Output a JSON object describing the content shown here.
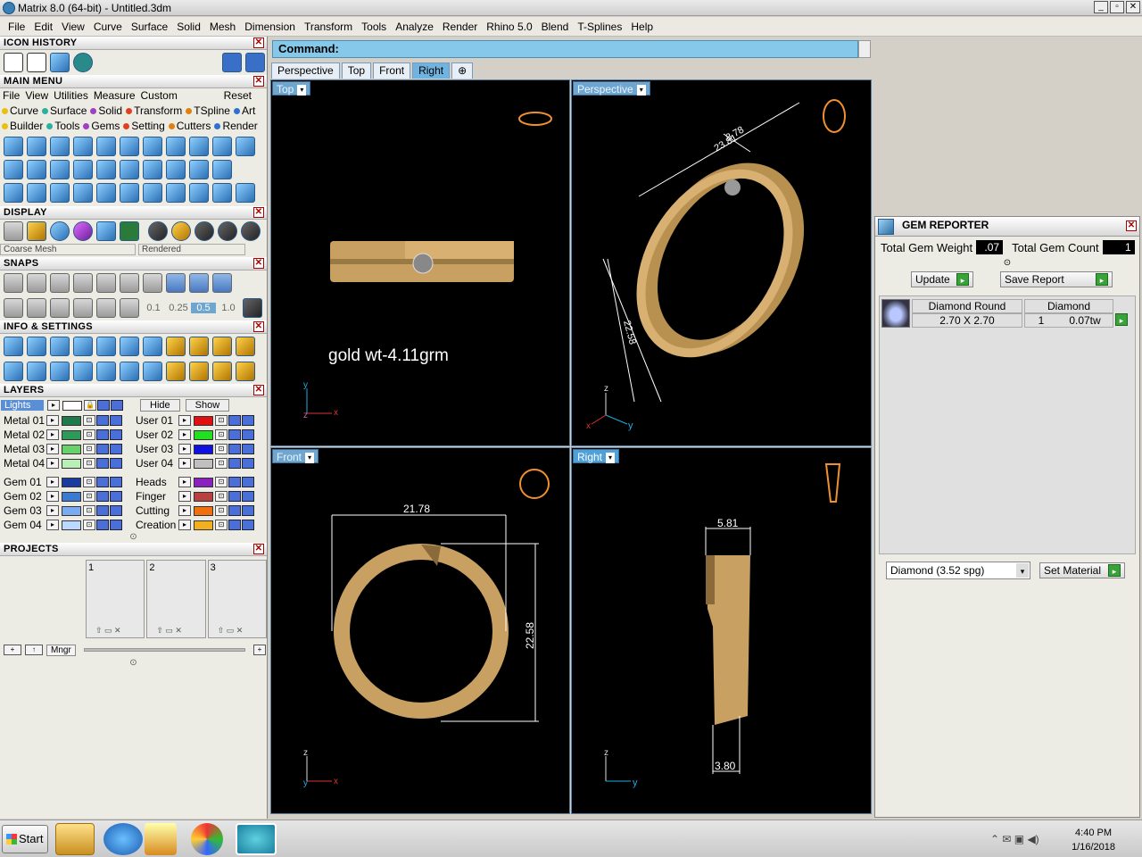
{
  "window": {
    "title": "Matrix 8.0 (64-bit) - Untitled.3dm"
  },
  "menubar": [
    "File",
    "Edit",
    "View",
    "Curve",
    "Surface",
    "Solid",
    "Mesh",
    "Dimension",
    "Transform",
    "Tools",
    "Analyze",
    "Render",
    "Rhino 5.0",
    "Blend",
    "T-Splines",
    "Help"
  ],
  "panels": {
    "icon_history": "ICON HISTORY",
    "main_menu": "MAIN MENU",
    "display": "DISPLAY",
    "snaps": "SNAPS",
    "info": "INFO & SETTINGS",
    "layers": "LAYERS",
    "projects": "PROJECTS"
  },
  "main_menu": {
    "menus": [
      "File",
      "View",
      "Utilities",
      "Measure",
      "Custom"
    ],
    "reset": "Reset",
    "row1": [
      "Curve",
      "Surface",
      "Solid",
      "Transform",
      "TSpline",
      "Art"
    ],
    "row2": [
      "Builder",
      "Tools",
      "Gems",
      "Setting",
      "Cutters",
      "Render"
    ],
    "dot_colors": [
      "#e8c010",
      "#2ab0a0",
      "#a040c0",
      "#e04020",
      "#e08010",
      "#3070d0"
    ]
  },
  "display": {
    "mesh": "Coarse Mesh",
    "mode": "Rendered"
  },
  "snaps": {
    "values": [
      "0.1",
      "0.25",
      "0.5",
      "1.0"
    ]
  },
  "layers": {
    "lights": "Lights",
    "hide": "Hide",
    "show": "Show",
    "left": [
      {
        "name": "Metal 01",
        "color": "#1e7a4a"
      },
      {
        "name": "Metal 02",
        "color": "#2e9a5a"
      },
      {
        "name": "Metal 03",
        "color": "#6ad06a"
      },
      {
        "name": "Metal 04",
        "color": "#b8f0b8"
      },
      {
        "name": "Gem 01",
        "color": "#1a3aa0"
      },
      {
        "name": "Gem 02",
        "color": "#3a7ad0"
      },
      {
        "name": "Gem 03",
        "color": "#7aaaf0"
      },
      {
        "name": "Gem 04",
        "color": "#bcd8ff"
      }
    ],
    "right": [
      {
        "name": "User 01",
        "color": "#e01010"
      },
      {
        "name": "User 02",
        "color": "#20e020"
      },
      {
        "name": "User 03",
        "color": "#1010e0"
      },
      {
        "name": "User 04",
        "color": "#c0c0c0"
      },
      {
        "name": "Heads",
        "color": "#8a20c0"
      },
      {
        "name": "Finger",
        "color": "#b84040"
      },
      {
        "name": "Cutting",
        "color": "#f07010"
      },
      {
        "name": "Creation",
        "color": "#f0b020"
      }
    ]
  },
  "projects": {
    "slots": [
      "1",
      "2",
      "3"
    ],
    "mngr": "Mngr"
  },
  "command": {
    "label": "Command:"
  },
  "view_tabs": [
    "Perspective",
    "Top",
    "Front",
    "Right"
  ],
  "viewports": {
    "top": {
      "label": "Top",
      "note": "gold wt-4.11grm"
    },
    "perspective": {
      "label": "Perspective",
      "dims": [
        "8.78",
        "23.81",
        "22.58"
      ]
    },
    "front": {
      "label": "Front",
      "dims": [
        "21.78",
        "22.58"
      ]
    },
    "right": {
      "label": "Right",
      "dims": [
        "5.81",
        "3.80"
      ]
    }
  },
  "gem_reporter": {
    "title": "GEM REPORTER",
    "weight_label": "Total Gem Weight",
    "weight": ".07",
    "count_label": "Total Gem Count",
    "count": "1",
    "update": "Update",
    "save_report": "Save Report",
    "gem": {
      "name": "Diamond Round",
      "size": "2.70 X 2.70",
      "material": "Diamond",
      "qty": "1",
      "tw": "0.07tw"
    },
    "material_select": "Diamond     (3.52 spg)",
    "set_material": "Set Material"
  },
  "taskbar": {
    "start": "Start",
    "time": "4:40 PM",
    "date": "1/16/2018"
  },
  "colors": {
    "gold": "#c8a062",
    "accent": "#86c8ea"
  }
}
